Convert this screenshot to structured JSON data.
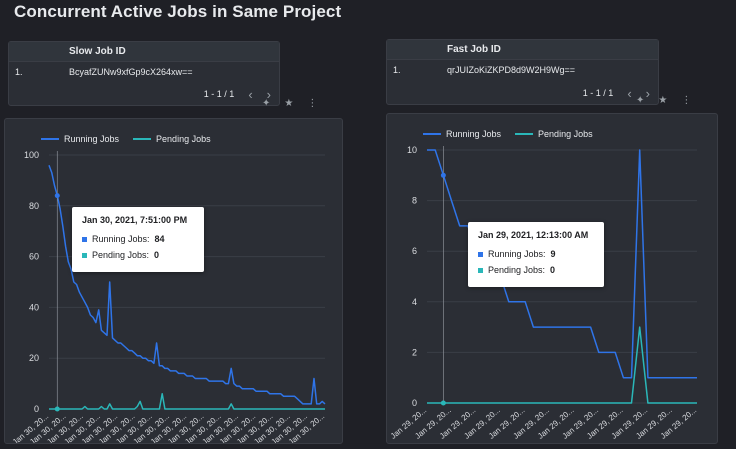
{
  "page": {
    "title": "Concurrent Active Jobs in Same Project"
  },
  "colors": {
    "running": "#2f74e8",
    "pending": "#2ab7b9",
    "grid": "#3a3e47",
    "axis_text": "#dadce0"
  },
  "icons": {
    "prev": "chevron-left-icon",
    "next": "chevron-right-icon",
    "edit": "edit-wand-icon",
    "explore": "explore-icon",
    "more": "more-vert-icon"
  },
  "slow_table": {
    "header": "Slow Job ID",
    "rows": [
      {
        "index": "1.",
        "id": "BcyafZUNw9xfGp9cX264xw=="
      }
    ],
    "pager": "1 - 1 / 1"
  },
  "fast_table": {
    "header": "Fast Job ID",
    "rows": [
      {
        "index": "1.",
        "id": "qrJUIZoKiZKPD8d9W2H9Wg=="
      }
    ],
    "pager": "1 - 1 / 1"
  },
  "slow_chart": {
    "legend": {
      "running": "Running Jobs",
      "pending": "Pending Jobs"
    },
    "tooltip": {
      "title": "Jan 30, 2021, 7:51:00 PM",
      "running_label": "Running Jobs:",
      "running_value": "84",
      "pending_label": "Pending Jobs:",
      "pending_value": "0"
    }
  },
  "fast_chart": {
    "legend": {
      "running": "Running Jobs",
      "pending": "Pending Jobs"
    },
    "tooltip": {
      "title": "Jan 29, 2021, 12:13:00 AM",
      "running_label": "Running Jobs:",
      "running_value": "9",
      "pending_label": "Pending Jobs:",
      "pending_value": "0"
    }
  },
  "chart_data": [
    {
      "type": "line",
      "ylim": [
        0,
        100
      ],
      "yticks": [
        0,
        20,
        40,
        60,
        80,
        100
      ],
      "x_tick_labels": [
        "Jan 30, 20...",
        "Jan 30, 20...",
        "Jan 30, 20...",
        "Jan 30, 20...",
        "Jan 30, 20...",
        "Jan 30, 20...",
        "Jan 30, 20...",
        "Jan 30, 20...",
        "Jan 30, 20...",
        "Jan 30, 20...",
        "Jan 30, 20...",
        "Jan 30, 20...",
        "Jan 30, 20...",
        "Jan 30, 20...",
        "Jan 30, 20...",
        "Jan 30, 20...",
        "Jan 30, 20..."
      ],
      "series": [
        {
          "name": "Running Jobs",
          "values": [
            96,
            93,
            88,
            84,
            79,
            72,
            64,
            58,
            55,
            50,
            49,
            46,
            44,
            42,
            40,
            37,
            36,
            34,
            39,
            31,
            30,
            29,
            50,
            28,
            27,
            26,
            26,
            25,
            24,
            23,
            23,
            22,
            21,
            21,
            20,
            20,
            19,
            19,
            18,
            26,
            17,
            17,
            16,
            16,
            15,
            15,
            15,
            14,
            14,
            14,
            13,
            13,
            13,
            12,
            12,
            12,
            12,
            12,
            11,
            11,
            11,
            11,
            11,
            11,
            10,
            10,
            16,
            10,
            9,
            9,
            8,
            8,
            8,
            8,
            8,
            7,
            7,
            7,
            7,
            7,
            6,
            6,
            6,
            6,
            6,
            5,
            5,
            5,
            5,
            5,
            4,
            3,
            2,
            2,
            2,
            2,
            12,
            2,
            2,
            3,
            2
          ]
        },
        {
          "name": "Pending Jobs",
          "values": [
            0,
            0,
            0,
            0,
            0,
            0,
            0,
            0,
            0,
            0,
            0,
            0,
            0,
            1,
            0,
            0,
            0,
            0,
            0,
            1,
            0,
            0,
            2,
            0,
            0,
            0,
            0,
            0,
            0,
            0,
            0,
            0,
            1,
            3,
            0,
            0,
            0,
            0,
            0,
            0,
            0,
            6,
            0,
            0,
            0,
            0,
            0,
            0,
            0,
            0,
            0,
            0,
            0,
            0,
            0,
            0,
            0,
            0,
            0,
            0,
            0,
            0,
            0,
            0,
            0,
            0,
            2,
            0,
            0,
            0,
            0,
            0,
            0,
            0,
            0,
            0,
            0,
            0,
            0,
            0,
            0,
            0,
            0,
            0,
            0,
            0,
            0,
            0,
            0,
            0,
            0,
            0,
            0,
            0,
            0,
            0,
            0,
            0,
            0,
            0,
            0
          ]
        }
      ]
    },
    {
      "type": "line",
      "ylim": [
        0,
        10
      ],
      "yticks": [
        0,
        2,
        4,
        6,
        8,
        10
      ],
      "x_tick_labels": [
        "Jan 29, 20...",
        "Jan 29, 20...",
        "Jan 29, 20...",
        "Jan 29, 20...",
        "Jan 29, 20...",
        "Jan 29, 20...",
        "Jan 29, 20...",
        "Jan 29, 20...",
        "Jan 29, 20...",
        "Jan 29, 20...",
        "Jan 29, 20...",
        "Jan 29, 20..."
      ],
      "series": [
        {
          "name": "Running Jobs",
          "values": [
            10,
            10,
            9,
            8,
            7,
            7,
            6,
            6,
            5,
            5,
            4,
            4,
            4,
            3,
            3,
            3,
            3,
            3,
            3,
            3,
            3,
            2,
            2,
            2,
            1,
            1,
            10,
            1,
            1,
            1,
            1,
            1,
            1,
            1
          ]
        },
        {
          "name": "Pending Jobs",
          "values": [
            0,
            0,
            0,
            0,
            0,
            0,
            0,
            0,
            0,
            0,
            0,
            0,
            0,
            0,
            0,
            0,
            0,
            0,
            0,
            0,
            0,
            0,
            0,
            0,
            0,
            0,
            3,
            0,
            0,
            0,
            0,
            0,
            0,
            0
          ]
        }
      ]
    }
  ]
}
